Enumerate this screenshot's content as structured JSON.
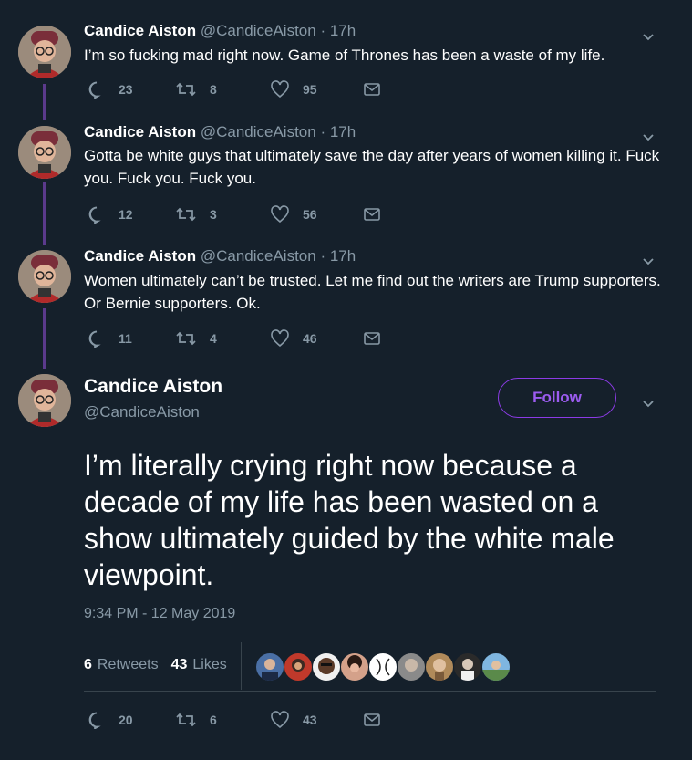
{
  "author": {
    "name": "Candice Aiston",
    "handle": "@CandiceAiston"
  },
  "colors": {
    "background": "#15202b",
    "secondary_text": "#8899a6",
    "thread_line": "#5b3a8c",
    "follow_accent": "#9c5cf0"
  },
  "thread": [
    {
      "name": "Candice Aiston",
      "meta": "@CandiceAiston · 17h",
      "text": "I’m so fucking mad right now. Game of Thrones has been a waste of my life.",
      "replies": "23",
      "retweets": "8",
      "likes": "95"
    },
    {
      "name": "Candice Aiston",
      "meta": "@CandiceAiston · 17h",
      "text": "Gotta be white guys that ultimately save the day after years of women killing it. Fuck you. Fuck you. Fuck you.",
      "replies": "12",
      "retweets": "3",
      "likes": "56"
    },
    {
      "name": "Candice Aiston",
      "meta": "@CandiceAiston · 17h",
      "text": "Women ultimately can’t be trusted. Let me find out the writers are Trump supporters. Or Bernie supporters. Ok.",
      "replies": "11",
      "retweets": "4",
      "likes": "46"
    }
  ],
  "main": {
    "name": "Candice Aiston",
    "handle": "@CandiceAiston",
    "follow_label": "Follow",
    "text": "I’m literally crying right now because a decade of my life has been wasted on a show ultimately guided by the white male viewpoint.",
    "timestamp": "9:34 PM - 12 May 2019",
    "retweet_count": "6",
    "retweet_label": "Retweets",
    "like_count": "43",
    "like_label": "Likes",
    "replies": "20",
    "retweets": "6",
    "likes": "43"
  }
}
